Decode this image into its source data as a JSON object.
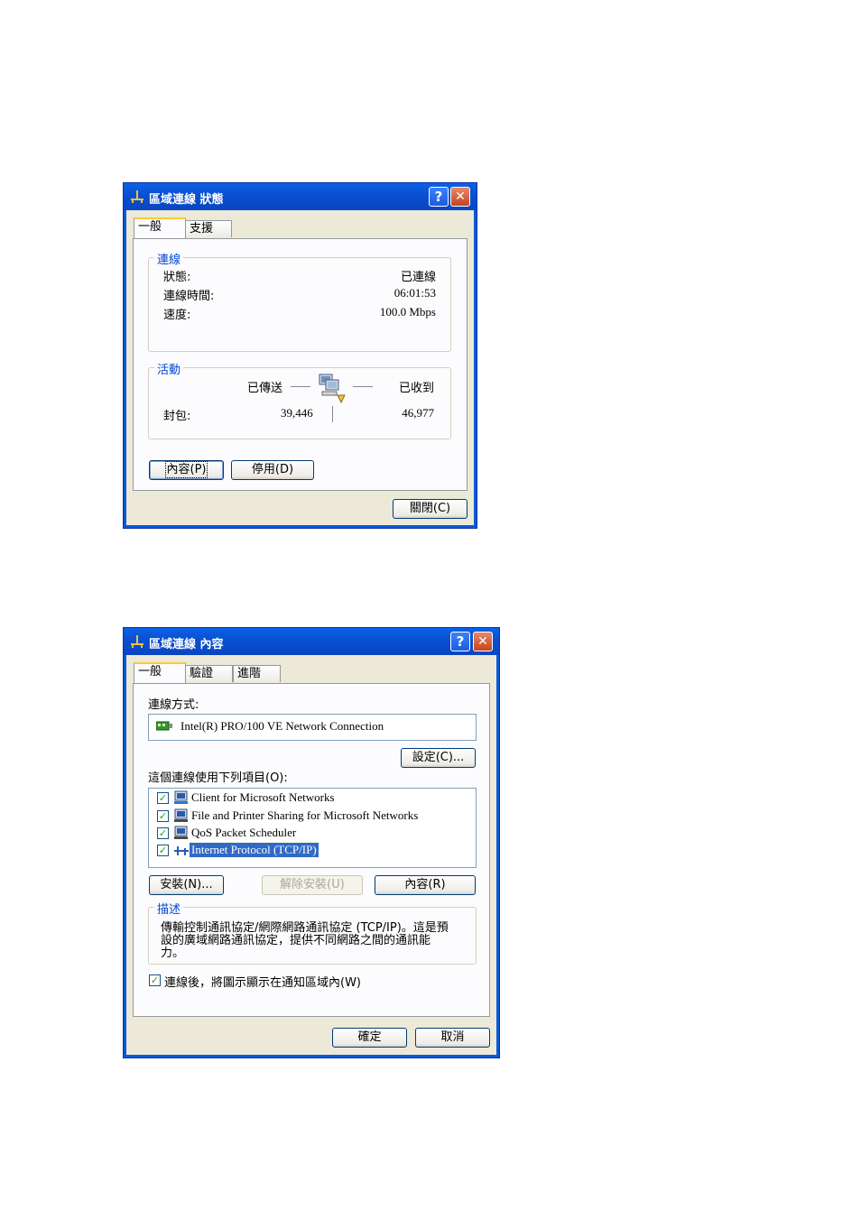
{
  "status_window": {
    "title": "區域連線 狀態",
    "tabs": [
      {
        "label": "一般"
      },
      {
        "label": "支援"
      }
    ],
    "connection_group": {
      "label": "連線",
      "rows": [
        {
          "label": "狀態:",
          "value": "已連線"
        },
        {
          "label": "連線時間:",
          "value": "06:01:53"
        },
        {
          "label": "速度:",
          "value": "100.0 Mbps"
        }
      ]
    },
    "activity_group": {
      "label": "活動",
      "sent_label": "已傳送",
      "received_label": "已收到",
      "packets_label": "封包:",
      "packets_sent": "39,446",
      "packets_received": "46,977"
    },
    "buttons": {
      "properties": "內容(P)",
      "disable": "停用(D)",
      "close": "關閉(C)"
    }
  },
  "props_window": {
    "title": "區域連線 內容",
    "tabs": [
      {
        "label": "一般"
      },
      {
        "label": "驗證"
      },
      {
        "label": "進階"
      }
    ],
    "connect_using_label": "連線方式:",
    "adapter_name": "Intel(R) PRO/100 VE Network Connection",
    "configure_button": "設定(C)...",
    "items_label": "這個連線使用下列項目(O):",
    "items": [
      {
        "label": "Client for Microsoft Networks",
        "checked": true,
        "icon": "network-client-icon"
      },
      {
        "label": "File and Printer Sharing for Microsoft Networks",
        "checked": true,
        "icon": "network-service-icon"
      },
      {
        "label": "QoS Packet Scheduler",
        "checked": true,
        "icon": "network-service-icon"
      },
      {
        "label": "Internet Protocol (TCP/IP)",
        "checked": true,
        "icon": "protocol-icon",
        "selected": true
      }
    ],
    "buttons": {
      "install": "安裝(N)...",
      "uninstall": "解除安裝(U)",
      "properties": "內容(R)",
      "ok": "確定",
      "cancel": "取消"
    },
    "description_group": {
      "label": "描述",
      "line1": "傳輸控制通訊協定/網際網路通訊協定 (TCP/IP)。這是預",
      "line2": "設的廣域網路通訊協定，提供不同網路之間的通訊能",
      "line3": "力。"
    },
    "show_icon_label": "連線後，將圖示顯示在通知區域內(W)",
    "show_icon_checked": true
  },
  "colors": {
    "titlebar": "#0a5ad6",
    "face": "#ece9d8",
    "group_label": "#0046d5",
    "selection": "#316ac5"
  }
}
